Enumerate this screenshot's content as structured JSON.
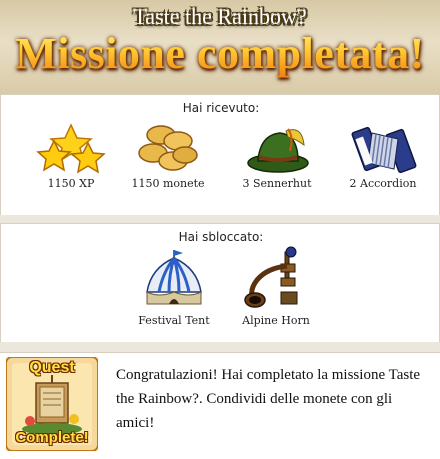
{
  "header": {
    "quest_name": "Taste the Rainbow?",
    "title": "Missione completata!"
  },
  "received": {
    "title": "Hai ricevuto:",
    "items": [
      {
        "label": "1150 XP",
        "icon": "stars-icon"
      },
      {
        "label": "1150 monete",
        "icon": "coins-icon"
      },
      {
        "label": "3 Sennerhut",
        "icon": "alpine-hat-icon"
      },
      {
        "label": "2 Accordion",
        "icon": "accordion-icon"
      }
    ]
  },
  "unlocked": {
    "title": "Hai sbloccato:",
    "items": [
      {
        "label": "Festival Tent",
        "icon": "festival-tent-icon"
      },
      {
        "label": "Alpine Horn",
        "icon": "alpine-horn-icon"
      }
    ]
  },
  "share": {
    "badge_top": "Quest",
    "badge_bottom": "Complete!",
    "message": "Congratulazioni! Hai completato la missione Taste the Rainbow?. Condividi delle monete con gli amici!"
  },
  "colors": {
    "title_gold": "#ffb11a",
    "header_bg": "#e3d7b9",
    "band_bg": "#ebe7dc"
  }
}
